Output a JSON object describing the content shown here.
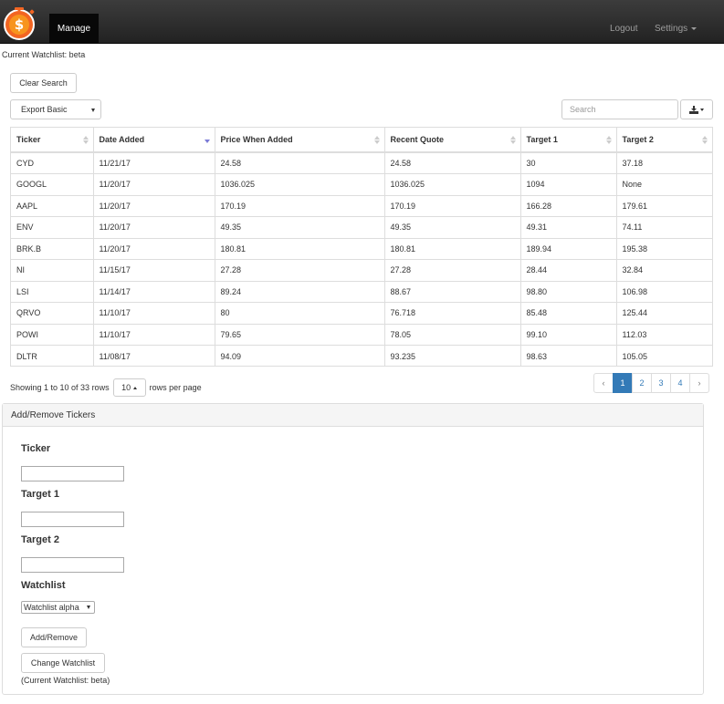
{
  "nav": {
    "brand_icon": "dollar-coin-icon",
    "manage_label": "Manage",
    "logout_label": "Logout",
    "settings_label": "Settings",
    "colors": {
      "bar": "#222222",
      "active": "#080808",
      "link": "#9d9d9d",
      "logo": "#f26522"
    }
  },
  "header": {
    "current_watchlist": "Current Watchlist: beta"
  },
  "toolbar": {
    "clear_search_label": "Clear Search",
    "export_select_value": "Export Basic",
    "search_placeholder": "Search",
    "export_icon": "download-icon"
  },
  "table": {
    "columns": [
      "Ticker",
      "Date Added",
      "Price When Added",
      "Recent Quote",
      "Target 1",
      "Target 2"
    ],
    "sorted_column": "Date Added",
    "rows": [
      [
        "CYD",
        "11/21/17",
        "24.58",
        "24.58",
        "30",
        "37.18"
      ],
      [
        "GOOGL",
        "11/20/17",
        "1036.025",
        "1036.025",
        "1094",
        "None"
      ],
      [
        "AAPL",
        "11/20/17",
        "170.19",
        "170.19",
        "166.28",
        "179.61"
      ],
      [
        "ENV",
        "11/20/17",
        "49.35",
        "49.35",
        "49.31",
        "74.11"
      ],
      [
        "BRK.B",
        "11/20/17",
        "180.81",
        "180.81",
        "189.94",
        "195.38"
      ],
      [
        "NI",
        "11/15/17",
        "27.28",
        "27.28",
        "28.44",
        "32.84"
      ],
      [
        "LSI",
        "11/14/17",
        "89.24",
        "88.67",
        "98.80",
        "106.98"
      ],
      [
        "QRVO",
        "11/10/17",
        "80",
        "76.718",
        "85.48",
        "125.44"
      ],
      [
        "POWI",
        "11/10/17",
        "79.65",
        "78.05",
        "99.10",
        "112.03"
      ],
      [
        "DLTR",
        "11/08/17",
        "94.09",
        "93.235",
        "98.63",
        "105.05"
      ]
    ]
  },
  "pagination": {
    "showing_text": "Showing 1 to 10 of 33 rows",
    "page_size": "10",
    "rows_per_page_text": "rows per page",
    "prev_label": "‹",
    "next_label": "›",
    "pages": [
      "1",
      "2",
      "3",
      "4"
    ],
    "active_page": "1",
    "active_color": "#337ab7"
  },
  "panel": {
    "title": "Add/Remove Tickers",
    "ticker_label": "Ticker",
    "target1_label": "Target 1",
    "target2_label": "Target 2",
    "watchlist_label": "Watchlist",
    "watchlist_select_value": "Watchlist alpha",
    "add_remove_label": "Add/Remove",
    "change_watchlist_label": "Change Watchlist",
    "current_watchlist_note": "(Current Watchlist: beta)"
  }
}
